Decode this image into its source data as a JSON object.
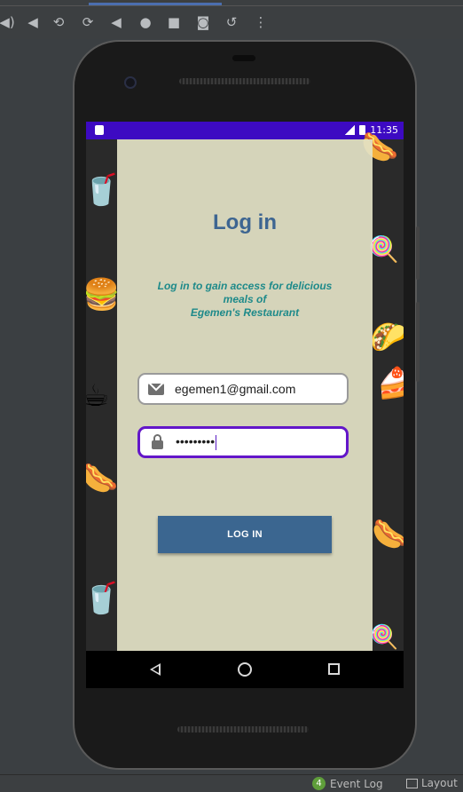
{
  "toolbar": {
    "icons": [
      "volume-up-icon",
      "volume-down-icon",
      "rotate-left-icon",
      "rotate-right-icon",
      "back-icon",
      "home-icon",
      "overview-icon",
      "camera-icon",
      "replay-icon",
      "more-icon"
    ]
  },
  "statusbar": {
    "time": "11:35"
  },
  "login": {
    "title": "Log in",
    "subtitle_line1": "Log in to gain access for delicious",
    "subtitle_line2": "meals of",
    "subtitle_line3": "Egemen's  Restaurant",
    "email_value": "egemen1@gmail.com",
    "password_value": "•••••••••",
    "button_label": "LOG IN"
  },
  "colors": {
    "status_bar": "#3d0ac2",
    "title": "#3d6591",
    "subtitle": "#1e8a8a",
    "button": "#3b6690",
    "password_focus": "#6316c9"
  },
  "bottom_bar": {
    "event_count": "4",
    "event_log": "Event Log",
    "layout": "Layout"
  }
}
